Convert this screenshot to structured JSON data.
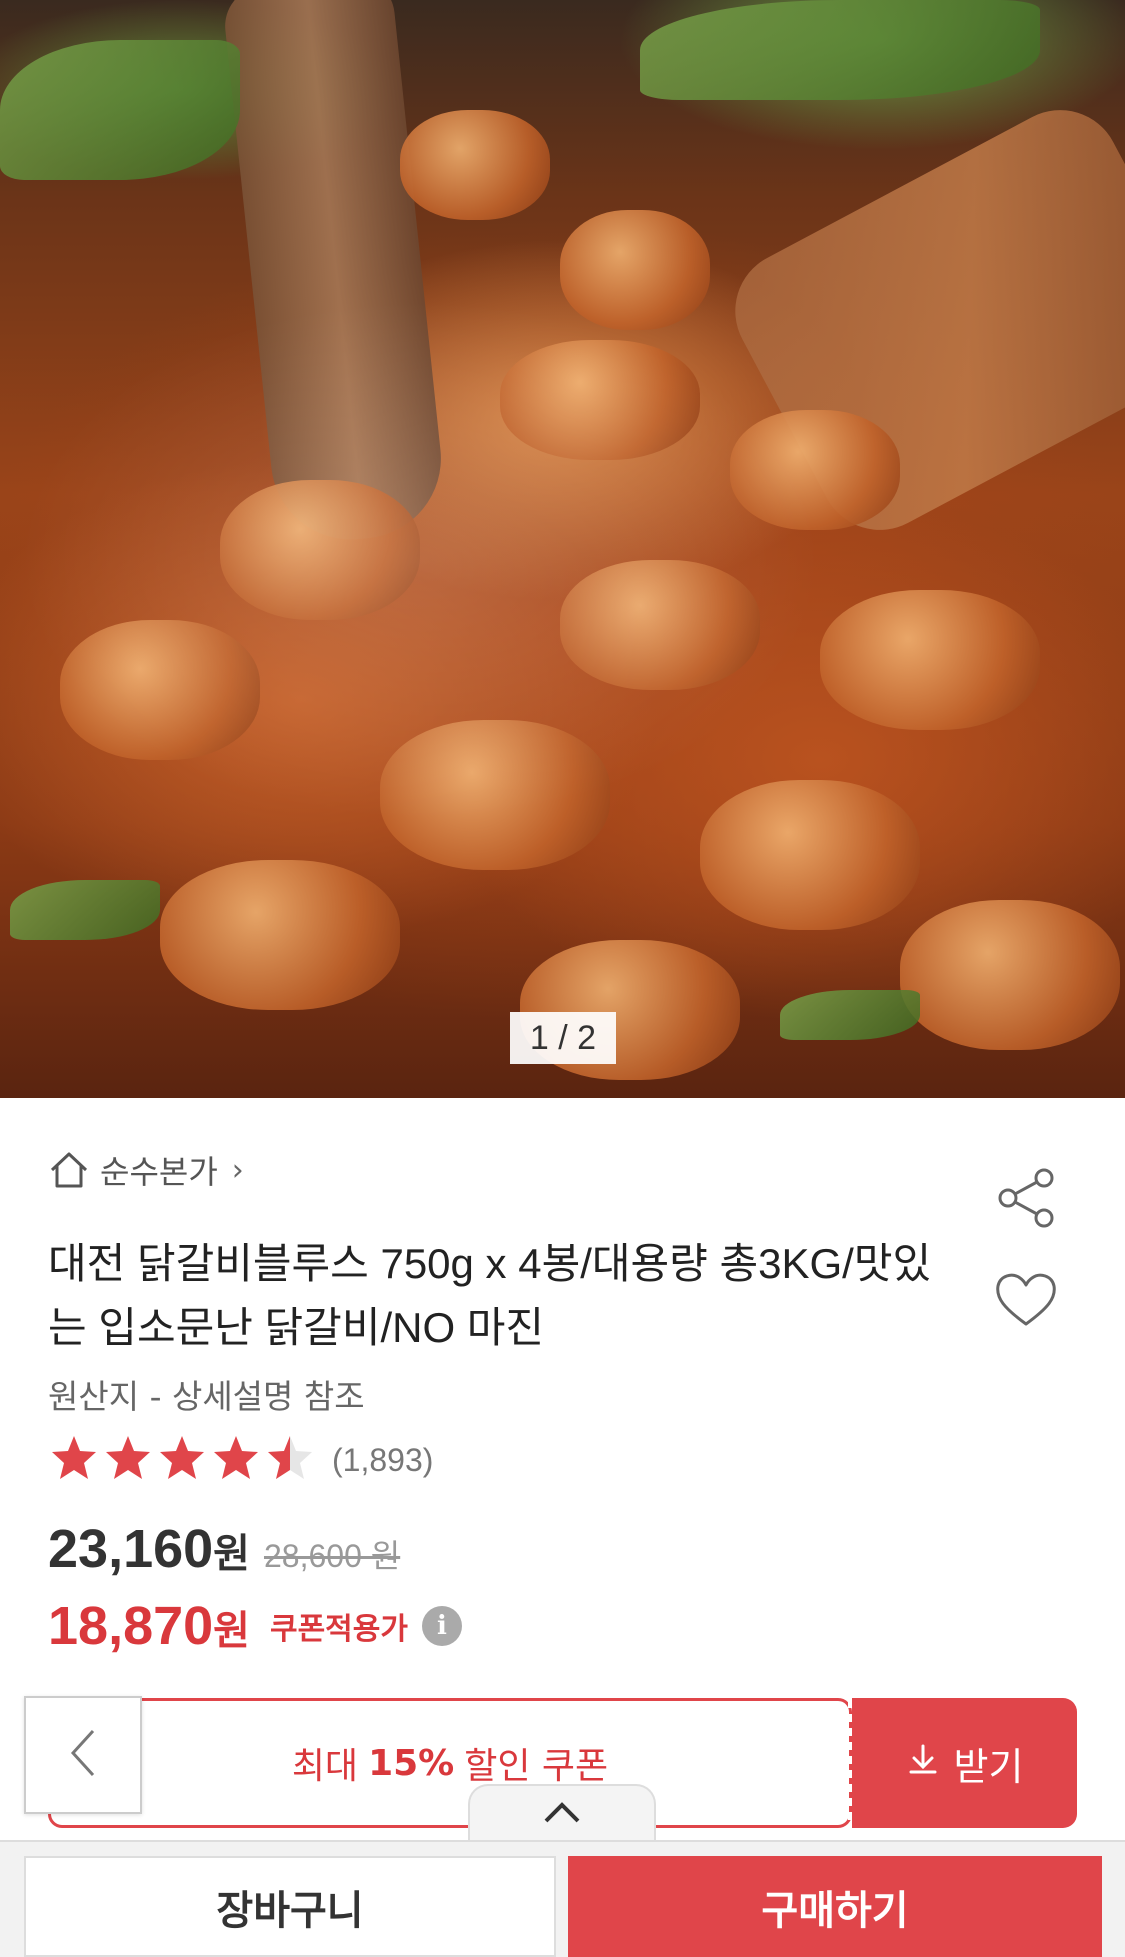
{
  "hero": {
    "image_alt": "닭갈비",
    "counter": "1 / 2"
  },
  "store": {
    "name": "순수본가",
    "chevron": "›"
  },
  "product": {
    "title": "대전 닭갈비블루스 750g x 4봉/대용량 총3KG/맛있는 입소문난 닭갈비/NO 마진",
    "origin": "원산지 - 상세설명 참조",
    "rating": 4.5,
    "review_count": "(1,893)",
    "price": "23,160",
    "price_unit": "원",
    "original_price": "28,600 원",
    "coupon_price": "18,870",
    "coupon_price_unit": "원",
    "coupon_price_label": "쿠폰적용가",
    "info_icon_glyph": "i"
  },
  "coupon": {
    "prefix": "최대",
    "percent": "15%",
    "suffix": "할인 쿠폰",
    "download_label": "받기"
  },
  "bottom": {
    "cart_label": "장바구니",
    "buy_label": "구매하기"
  },
  "colors": {
    "accent": "#e0454a",
    "star": "#e0454a",
    "text": "#222222"
  }
}
